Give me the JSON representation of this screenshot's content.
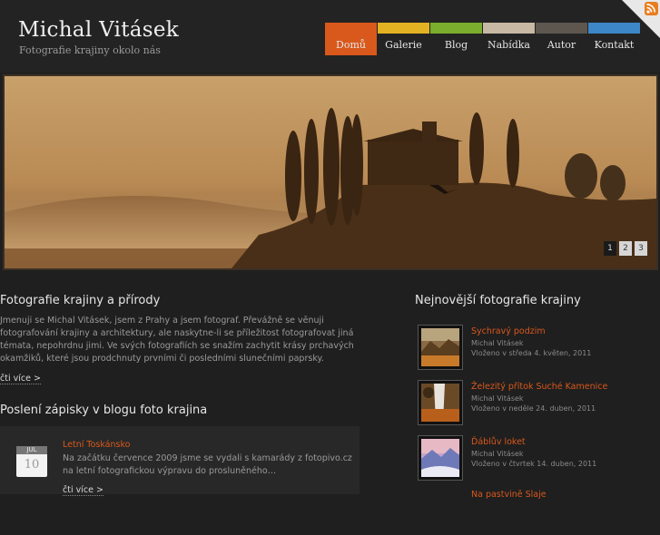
{
  "site": {
    "title": "Michal Vitásek",
    "subtitle": "Fotografie krajiny okolo nás"
  },
  "nav": [
    {
      "label": "Domů",
      "color": "#d9581c",
      "active": true
    },
    {
      "label": "Galerie",
      "color": "#e3b222"
    },
    {
      "label": "Blog",
      "color": "#7aae2c"
    },
    {
      "label": "Nabídka",
      "color": "#c7b9a3"
    },
    {
      "label": "Autor",
      "color": "#5d5750"
    },
    {
      "label": "Kontakt",
      "color": "#3d86c7"
    }
  ],
  "rss_icon": "rss-feed-icon",
  "slider": {
    "pages": [
      "1",
      "2",
      "3"
    ],
    "active_page": 1
  },
  "intro": {
    "heading": "Fotografie krajiny a přírody",
    "text": "Jmenuji se Michal Vitásek, jsem z Prahy a jsem fotograf. Převážně se věnuji fotografování krajiny a architektury, ale naskytne-li se příležitost fotografovat jiná témata, nepohrdnu jimi. Ve svých fotografiích se snažím zachytit krásy prchavých okamžiků, které jsou prodchnuty prvními či posledními slunečními paprsky.",
    "more": "čti více >"
  },
  "blog": {
    "heading": "Poslení zápisky v blogu foto krajina",
    "post": {
      "month": "JUL",
      "day": "10",
      "title": "Letní Toskánsko",
      "text": "Na začátku července 2009 jsme se vydali s kamarády z fotopivo.cz na letní fotografickou výpravu do prosluněného…",
      "more": "čti více >"
    }
  },
  "latest": {
    "heading": "Nejnovější fotografie krajiny",
    "items": [
      {
        "title": "Sychravý podzim",
        "author": "Michal Vitásek",
        "date": "Vloženo v středa 4. květen, 2011"
      },
      {
        "title": "Železitý přítok Suché Kamenice",
        "author": "Michal Vitásek",
        "date": "Vloženo v neděle 24. duben, 2011"
      },
      {
        "title": "Ďáblův loket",
        "author": "Michal Vitásek",
        "date": "Vloženo v čtvrtek 14. duben, 2011"
      },
      {
        "title": "Na pastvině Slaje",
        "author": "",
        "date": ""
      }
    ]
  }
}
